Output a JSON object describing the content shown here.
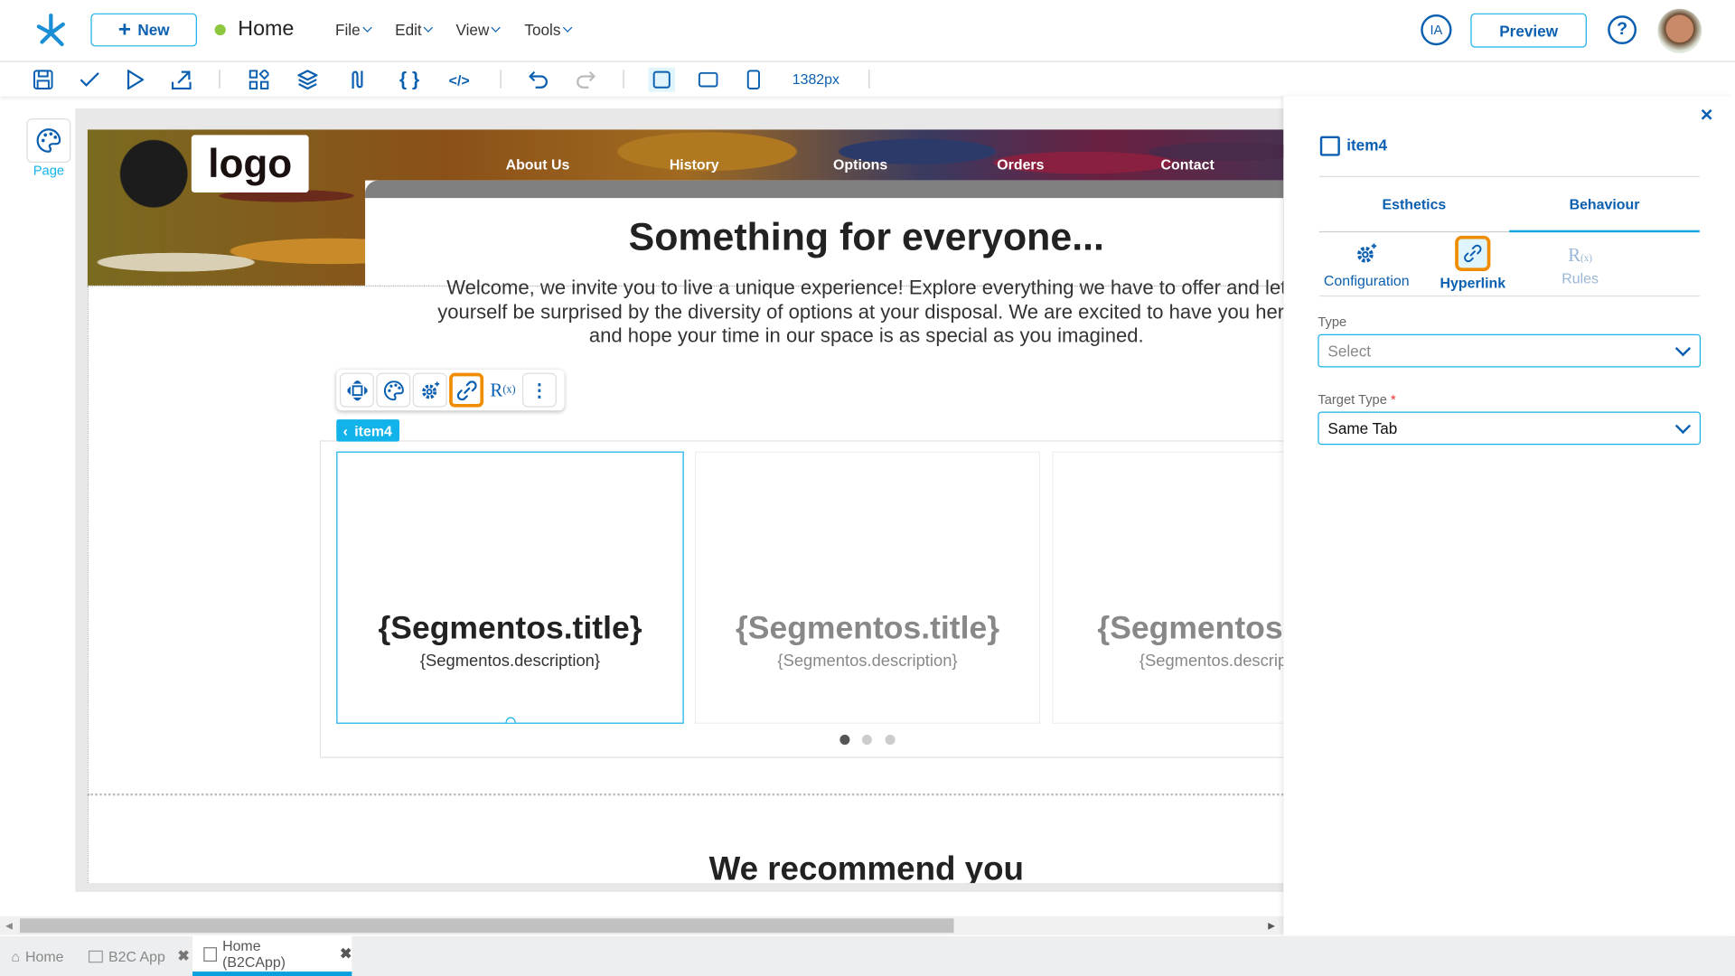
{
  "topbar": {
    "new_label": "New",
    "page_title": "Home",
    "status_color": "#8dc63f",
    "menus": [
      "File",
      "Edit",
      "View",
      "Tools"
    ],
    "ia_label": "IA",
    "preview_label": "Preview"
  },
  "toolbar": {
    "width_label": "1382px"
  },
  "sidebar": {
    "page_label": "Page"
  },
  "site": {
    "logo": "logo",
    "nav": [
      "About Us",
      "History",
      "Options",
      "Orders",
      "Contact"
    ],
    "title": "Something for everyone...",
    "paragraph": [
      "Welcome, we invite you to live a unique experience! Explore everything we have to offer and let",
      "yourself be surprised by the diversity of options at your disposal. We are excited to have you here",
      "and hope your time in our space is as special as you imagined."
    ],
    "cards": [
      {
        "title": "{Segmentos.title}",
        "description": "{Segmentos.description}"
      },
      {
        "title": "{Segmentos.title}",
        "description": "{Segmentos.description}"
      },
      {
        "title": "{Segmentos.title}",
        "description": "{Segmentos.description}"
      }
    ],
    "section2_title": "We recommend you"
  },
  "selection": {
    "tag": "item4"
  },
  "panel": {
    "item_name": "item4",
    "tabs": [
      "Esthetics",
      "Behaviour"
    ],
    "active_tab": "Behaviour",
    "subtabs": [
      "Configuration",
      "Hyperlink",
      "Rules"
    ],
    "active_subtab": "Hyperlink",
    "type_label": "Type",
    "type_value": "Select",
    "target_label": "Target Type",
    "target_required": "*",
    "target_value": "Same Tab"
  },
  "bottom_tabs": [
    {
      "label": "Home"
    },
    {
      "label": "B2C App"
    },
    {
      "label": "Home (B2CApp)",
      "active": true
    }
  ],
  "colors": {
    "accent": "#0b5fb0",
    "highlight": "#f08c00",
    "selection": "#12b3ea"
  }
}
